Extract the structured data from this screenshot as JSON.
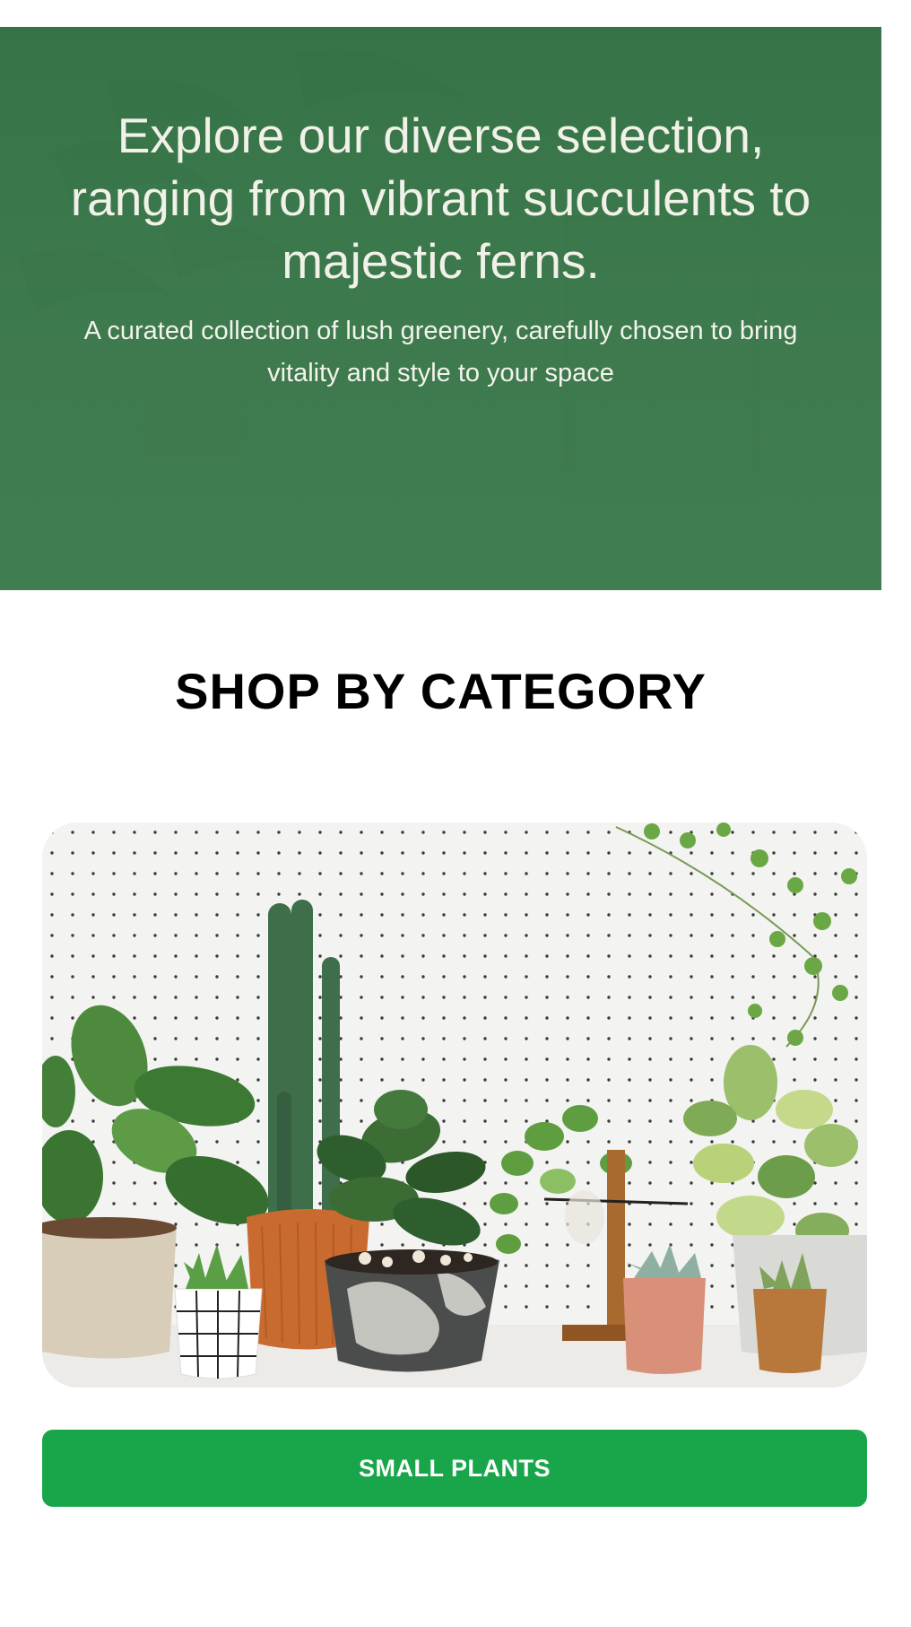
{
  "hero": {
    "title": "Explore our diverse selection, ranging from vibrant succulents to majestic ferns.",
    "subtitle": "A curated collection of lush greenery, carefully chosen to bring vitality and style to your space",
    "overlay_color": "#3f7a4f"
  },
  "section": {
    "title": "SHOP BY CATEGORY"
  },
  "categories": [
    {
      "image_icon": "potted-plants-image",
      "button_label": "SMALL PLANTS",
      "button_color": "#19a54a"
    }
  ]
}
